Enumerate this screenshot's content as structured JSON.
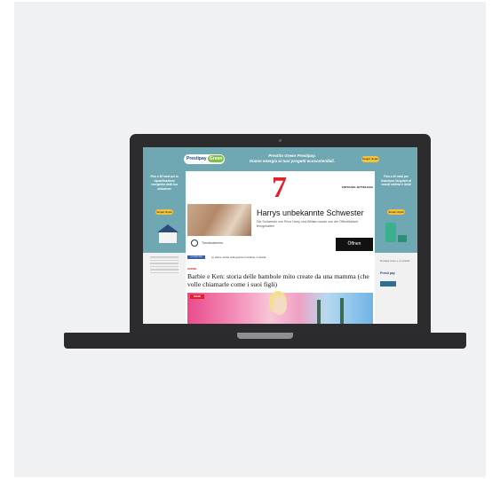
{
  "ad_banner": {
    "brand_prefix": "Prestipay",
    "brand_suffix": "Green",
    "headline_line1": "Prestito Green Prestipay.",
    "headline_line2": "Diamo energia ai tuoi progetti ecosostenibili.",
    "cta": "Scopri di più"
  },
  "left_skin": {
    "text": "Fino a 30 mesi per la riqualificazione energetica della tua abitazione",
    "cta": "Scopri di più"
  },
  "right_skin": {
    "text": "Fino a 30 mesi per finanziare l'acquisto di veicoli elettrici e ibridi",
    "cta": "Scopri di più",
    "small_text": "Prestipay Green è un prodotto",
    "logo": "Presti pay"
  },
  "masthead": {
    "logo": "7",
    "login": "ENTRA NEL SETTE/LEGGI"
  },
  "sponsored": {
    "title": "Harrys unbekannte Schwester",
    "description": "Die Schwester von Prinz Harry und William wurde von der Öffentlichkeit ferngehalten",
    "sponsor": "Trendscatchers",
    "open_button": "Öffnen"
  },
  "ticker": {
    "badge": "ULTIMA ORA",
    "text": "Le ultime notizie sulla guerra in Ucraina, in diretta"
  },
  "article": {
    "section": "SCENE",
    "headline": "Barbie e Ken: storia delle bambole mito create da una mamma (che volle chiamarle come i suoi figli)",
    "hero_badge": "SCENE"
  }
}
